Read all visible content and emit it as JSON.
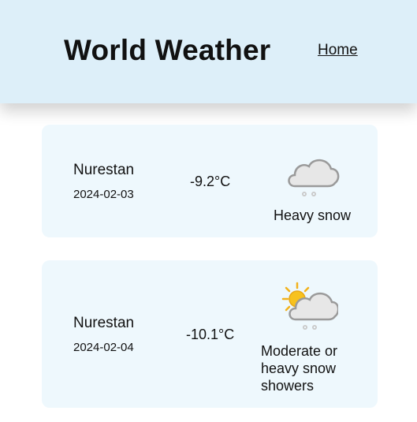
{
  "header": {
    "title": "World Weather",
    "nav_home": "Home"
  },
  "forecasts": [
    {
      "location": "Nurestan",
      "date": "2024-02-03",
      "temperature": "-9.2°C",
      "condition": "Heavy snow",
      "icon": "snow-cloud-icon"
    },
    {
      "location": "Nurestan",
      "date": "2024-02-04",
      "temperature": "-10.1°C",
      "condition": "Moderate or heavy snow showers",
      "icon": "sun-snow-cloud-icon"
    }
  ],
  "colors": {
    "header_bg": "#ddeff9",
    "card_bg": "#eef8fd"
  }
}
